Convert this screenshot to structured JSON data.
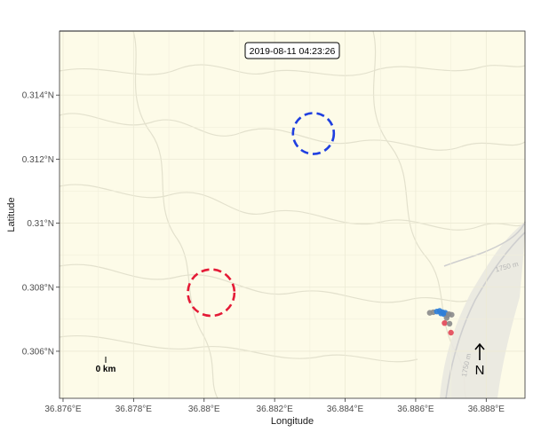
{
  "timestamp_label": "2019-08-11 04:23:26",
  "x_axis": {
    "label": "Longitude",
    "ticks": [
      {
        "value": 36.876,
        "label": "36.876°E"
      },
      {
        "value": 36.878,
        "label": "36.878°E"
      },
      {
        "value": 36.88,
        "label": "36.88°E"
      },
      {
        "value": 36.882,
        "label": "36.882°E"
      },
      {
        "value": 36.884,
        "label": "36.884°E"
      },
      {
        "value": 36.886,
        "label": "36.886°E"
      },
      {
        "value": 36.888,
        "label": "36.888°E"
      }
    ]
  },
  "y_axis": {
    "label": "Latitude",
    "ticks": [
      {
        "value": 0.306,
        "label": "0.306°N"
      },
      {
        "value": 0.308,
        "label": "0.308°N"
      },
      {
        "value": 0.31,
        "label": "0.31°N"
      },
      {
        "value": 0.312,
        "label": "0.312°N"
      },
      {
        "value": 0.314,
        "label": "0.314°N"
      }
    ]
  },
  "extent": {
    "lon": [
      36.8759,
      36.8891
    ],
    "lat": [
      0.30453,
      0.316
    ]
  },
  "contour_labels": [
    {
      "text": "1750 m",
      "lon": 36.8886,
      "lat": 0.30857,
      "angle": -15
    },
    {
      "text": "1750 m",
      "lon": 36.8875,
      "lat": 0.30555,
      "angle": -78
    }
  ],
  "zones": [
    {
      "name": "blue",
      "lon": 36.8831,
      "lat": 0.3128,
      "radius_deg": 0.00058,
      "color": "#1f3fe0"
    },
    {
      "name": "red",
      "lon": 36.8802,
      "lat": 0.30783,
      "radius_deg": 0.00066,
      "color": "#e41a36"
    }
  ],
  "points": [
    {
      "lon": 36.8864,
      "lat": 0.3072,
      "color": "#8c8c8c"
    },
    {
      "lon": 36.8865,
      "lat": 0.30722,
      "color": "#8c8c8c"
    },
    {
      "lon": 36.8866,
      "lat": 0.30724,
      "color": "#2f7fd8"
    },
    {
      "lon": 36.88668,
      "lat": 0.30726,
      "color": "#2f7fd8"
    },
    {
      "lon": 36.88672,
      "lat": 0.30718,
      "color": "#2f7fd8"
    },
    {
      "lon": 36.88676,
      "lat": 0.30722,
      "color": "#2f7fd8"
    },
    {
      "lon": 36.8868,
      "lat": 0.30716,
      "color": "#2f7fd8"
    },
    {
      "lon": 36.88684,
      "lat": 0.3072,
      "color": "#2f7fd8"
    },
    {
      "lon": 36.8869,
      "lat": 0.30712,
      "color": "#2f7fd8"
    },
    {
      "lon": 36.88694,
      "lat": 0.30716,
      "color": "#8c8c8c"
    },
    {
      "lon": 36.88702,
      "lat": 0.30714,
      "color": "#8c8c8c"
    },
    {
      "lon": 36.88688,
      "lat": 0.30704,
      "color": "#8c8c8c"
    },
    {
      "lon": 36.88682,
      "lat": 0.30688,
      "color": "#e34a5a"
    },
    {
      "lon": 36.88696,
      "lat": 0.30686,
      "color": "#8c8c8c"
    },
    {
      "lon": 36.887,
      "lat": 0.30658,
      "color": "#e34a5a"
    }
  ],
  "scale_bar": {
    "label": "0 km"
  },
  "north_arrow": {
    "label": "N"
  },
  "colors": {
    "panel": "#fdfbe8",
    "grid": "#ecead5",
    "terrain": "#e2e0cc",
    "ridge": "#c8c8c8"
  }
}
